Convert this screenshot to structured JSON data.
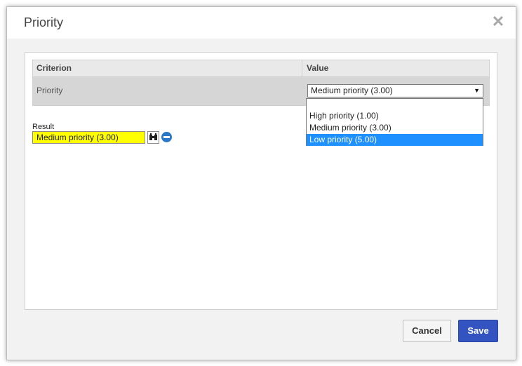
{
  "dialog": {
    "title": "Priority",
    "close_icon": "close-icon"
  },
  "grid": {
    "columns": [
      "Criterion",
      "Value"
    ],
    "rows": [
      {
        "criterion": "Priority",
        "value": "Medium priority (3.00)"
      }
    ]
  },
  "dropdown": {
    "options": [
      "",
      "High priority (1.00)",
      "Medium priority (3.00)",
      "Low priority (5.00)"
    ],
    "highlighted": "Low priority (5.00)"
  },
  "result": {
    "label": "Result",
    "value": "Medium priority (3.00)",
    "highlight_color": "#ffff00",
    "search_icon": "binoculars-icon",
    "clear_icon": "minus-circle-icon"
  },
  "footer": {
    "cancel_label": "Cancel",
    "save_label": "Save",
    "save_color": "#3354c0"
  }
}
